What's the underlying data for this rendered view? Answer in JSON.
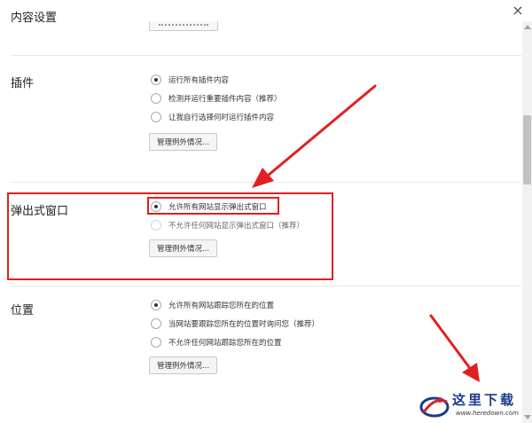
{
  "dialog": {
    "title": "内容设置",
    "close_glyph": "×"
  },
  "sections": {
    "plugins": {
      "title": "插件",
      "options": [
        {
          "label": "运行所有插件内容",
          "checked": true
        },
        {
          "label": "检测并运行重要插件内容（推荐）",
          "checked": false
        },
        {
          "label": "让我自行选择何时运行插件内容",
          "checked": false
        }
      ],
      "manage_label": "管理例外情况..."
    },
    "popups": {
      "title": "弹出式窗口",
      "options": [
        {
          "label": "允许所有网站显示弹出式窗口",
          "checked": true
        },
        {
          "label": "不允许任何网站显示弹出式窗口（推荐）",
          "checked": false
        }
      ],
      "manage_label": "管理例外情况..."
    },
    "location": {
      "title": "位置",
      "options": [
        {
          "label": "允许所有网站跟踪您所在的位置",
          "checked": true
        },
        {
          "label": "当网站要跟踪您所在的位置时询问您（推荐）",
          "checked": false
        },
        {
          "label": "不允许任何网站跟踪您所在的位置",
          "checked": false
        }
      ],
      "manage_label": "管理例外情况..."
    }
  },
  "annotations": {
    "highlight_color": "#e02020",
    "arrow_color": "#e02020"
  },
  "watermark": {
    "text": "这里下载",
    "url": "www.heredown.com"
  }
}
